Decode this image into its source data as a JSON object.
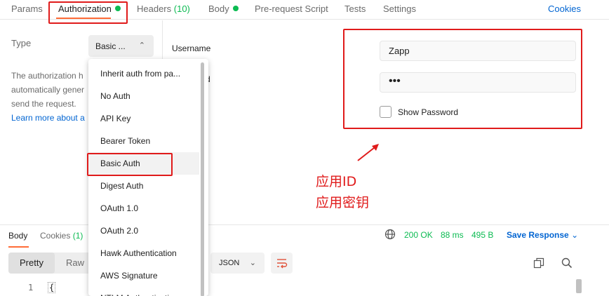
{
  "tabs": [
    {
      "label": "Params"
    },
    {
      "label": "Authorization"
    },
    {
      "label": "Headers",
      "count": "(10)"
    },
    {
      "label": "Body"
    },
    {
      "label": "Pre-request Script"
    },
    {
      "label": "Tests"
    },
    {
      "label": "Settings"
    }
  ],
  "cookies_link": "Cookies",
  "auth": {
    "type_label": "Type",
    "type_value": "Basic ...",
    "help_lines": [
      "The authorization h",
      "automatically gener",
      "send the request."
    ],
    "help_link": "Learn more about a",
    "username_label": "Username",
    "password_label_fragment": "d",
    "username_value": "Zapp",
    "password_value": "•••",
    "show_password_label": "Show Password"
  },
  "type_menu": {
    "items": [
      "Inherit auth from pa...",
      "No Auth",
      "API Key",
      "Bearer Token",
      "Basic Auth",
      "Digest Auth",
      "OAuth 1.0",
      "OAuth 2.0",
      "Hawk Authentication",
      "AWS Signature",
      "NTLM Authentication"
    ],
    "selected": "Basic Auth"
  },
  "annotation": {
    "line1": "应用ID",
    "line2": "应用密钥",
    "color": "#e01b1b"
  },
  "response": {
    "tabs": [
      {
        "label": "Body"
      },
      {
        "label": "Cookies",
        "count": "(1)"
      }
    ],
    "status": "200 OK",
    "time": "88 ms",
    "size": "495 B",
    "save_label": "Save Response",
    "view_pretty": "Pretty",
    "view_raw": "Raw",
    "format": "JSON",
    "line_number": "1",
    "code_first_char": "{"
  },
  "colors": {
    "accent": "#ff6c37",
    "success": "#0cbb52",
    "link": "#0265d2",
    "annotation_red": "#e01b1b"
  }
}
